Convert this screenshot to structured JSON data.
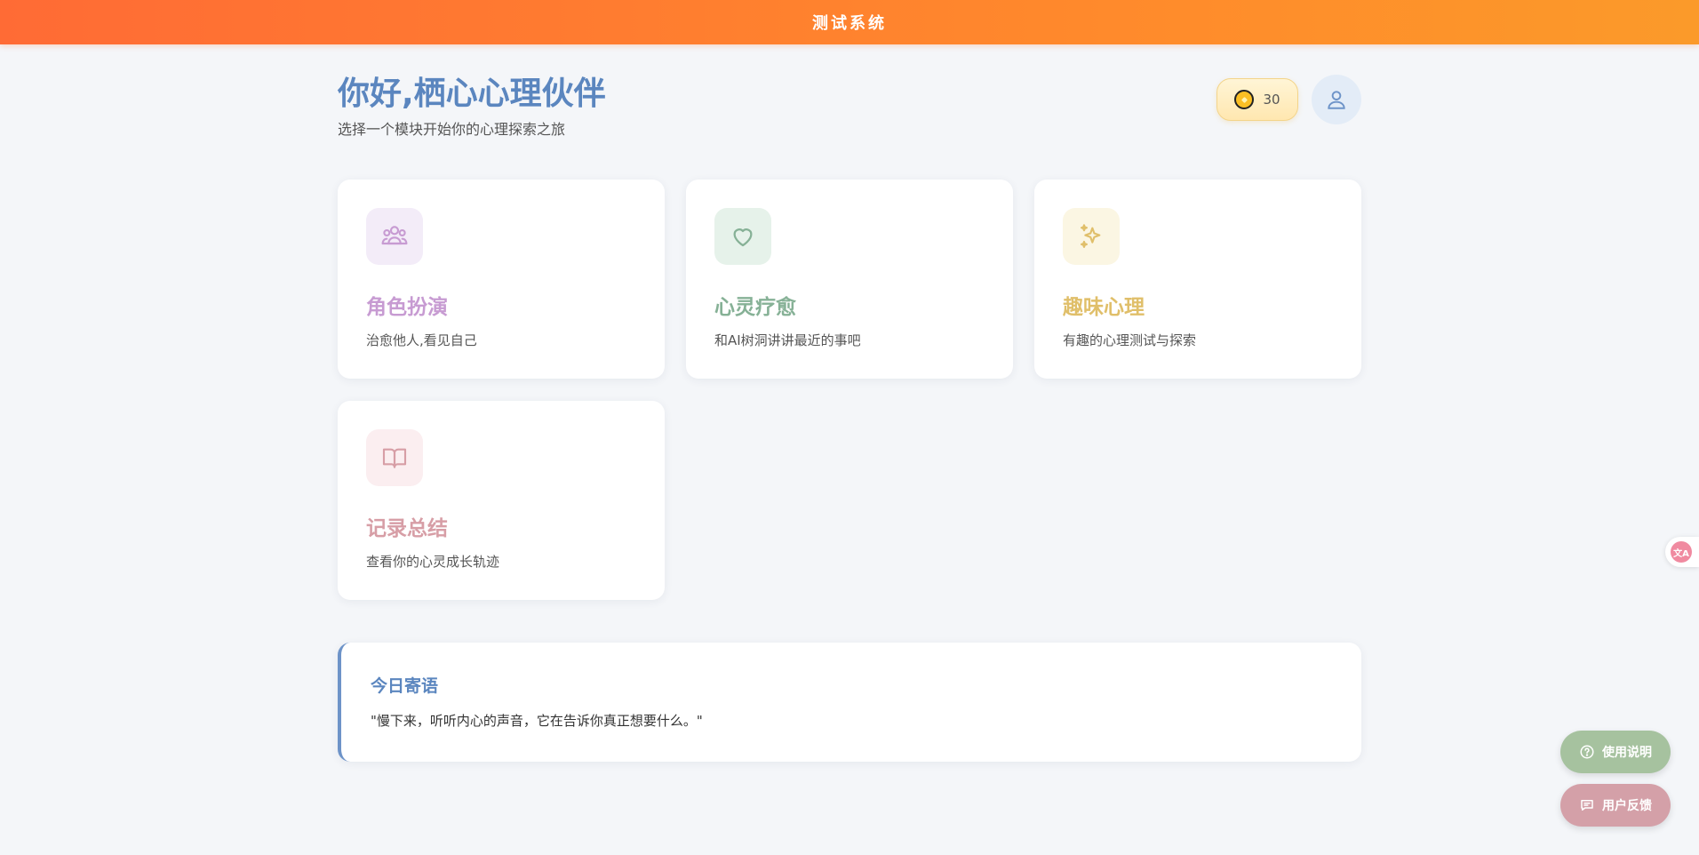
{
  "header": {
    "title": "测试系统"
  },
  "greeting": {
    "title": "你好,栖心心理伙伴",
    "subtitle": "选择一个模块开始你的心理探索之旅"
  },
  "coins": {
    "count": "30",
    "icon": "coin-icon"
  },
  "profile": {
    "icon": "user-icon"
  },
  "modules": [
    {
      "title": "角色扮演",
      "description": "治愈他人,看见自己",
      "icon": "users-icon",
      "color": "#c79bd2",
      "icon_bg": "#f3ecf8"
    },
    {
      "title": "心灵疗愈",
      "description": "和AI树洞讲讲最近的事吧",
      "icon": "heart-icon",
      "color": "#86b196",
      "icon_bg": "#e6f2ea"
    },
    {
      "title": "趣味心理",
      "description": "有趣的心理测试与探索",
      "icon": "sparkles-icon",
      "color": "#e0bf6a",
      "icon_bg": "#fbf6e3"
    },
    {
      "title": "记录总结",
      "description": "查看你的心灵成长轨迹",
      "icon": "book-icon",
      "color": "#d79ea6",
      "icon_bg": "#fbeef0"
    }
  ],
  "daily_quote": {
    "title": "今日寄语",
    "text": "\"慢下来，听听内心的声音，它在告诉你真正想要什么。\""
  },
  "floating": {
    "help_label": "使用说明",
    "feedback_label": "用户反馈"
  },
  "colors": {
    "accent_blue": "#5b86bf",
    "header_gradient_start": "#ff6b35",
    "header_gradient_end": "#fb9a2a"
  }
}
